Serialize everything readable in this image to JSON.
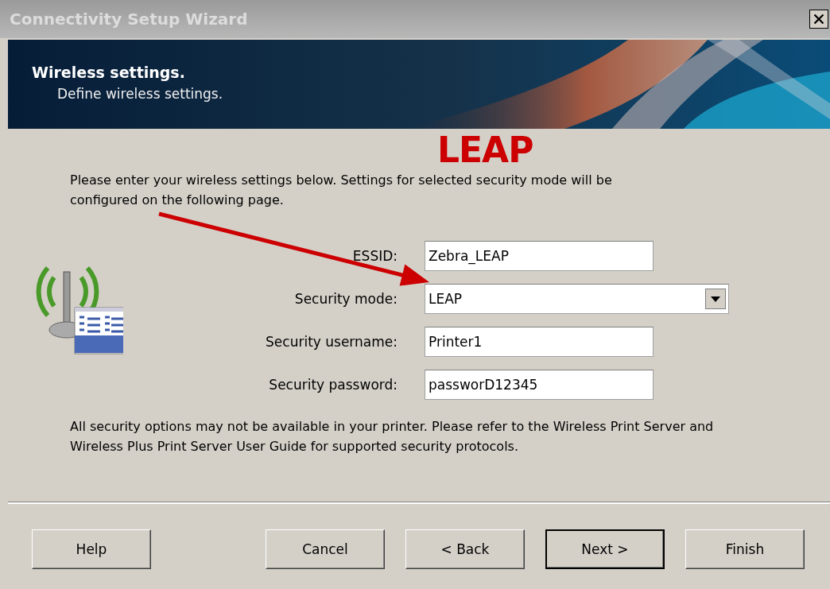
{
  "window": {
    "title": "Connectivity Setup Wizard"
  },
  "header": {
    "title": "Wireless settings.",
    "subtitle": "Define wireless settings."
  },
  "intro": "Please enter your wireless settings below. Settings for selected security mode will be configured on the following page.",
  "annotation": {
    "label": "LEAP"
  },
  "fields": [
    {
      "kind": "text",
      "label": "ESSID:",
      "value": "Zebra_LEAP"
    },
    {
      "kind": "dropdown",
      "label": "Security mode:",
      "value": "LEAP"
    },
    {
      "kind": "text",
      "label": "Security username:",
      "value": "Printer1"
    },
    {
      "kind": "text",
      "label": "Security password:",
      "value": "passworD12345"
    }
  ],
  "note": "All security options may not be available in your printer. Please refer to the Wireless Print Server and Wireless Plus Print Server User Guide for supported security protocols.",
  "buttons": [
    {
      "label": "Help",
      "default": false
    },
    {
      "label": "Cancel",
      "default": false
    },
    {
      "label": "< Back",
      "default": false
    },
    {
      "label": "Next >",
      "default": true
    },
    {
      "label": "Finish",
      "default": false
    }
  ]
}
